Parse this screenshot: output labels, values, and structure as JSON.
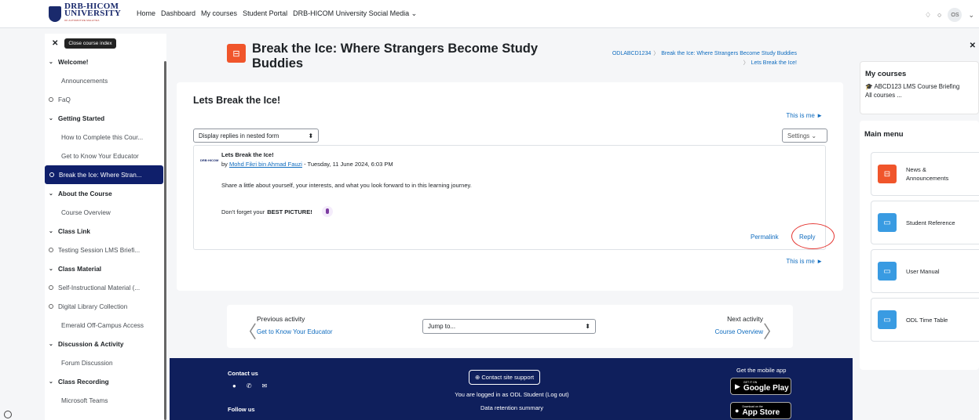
{
  "topbar": {
    "logo_line1": "DRB-HICOM",
    "logo_line2": "UNIVERSITY",
    "logo_tag": "OF AUTOMOTIVE MALAYSIA",
    "nav": [
      "Home",
      "Dashboard",
      "My courses",
      "Student Portal",
      "DRB-HICOM University Social Media ⌄"
    ],
    "bell": "♫",
    "chat": "▭",
    "avatar": "OS",
    "avatar_caret": "⌄"
  },
  "sidebar": {
    "close_tooltip": "Close course index",
    "items": [
      {
        "type": "section",
        "label": "Welcome!"
      },
      {
        "type": "item",
        "label": "Announcements"
      },
      {
        "type": "circle",
        "label": "FaQ"
      },
      {
        "type": "section",
        "label": "Getting Started"
      },
      {
        "type": "item",
        "label": "How to Complete this Cour..."
      },
      {
        "type": "item",
        "label": "Get to Know Your Educator"
      },
      {
        "type": "active",
        "label": "Break the Ice: Where Stran..."
      },
      {
        "type": "section",
        "label": "About the Course"
      },
      {
        "type": "item",
        "label": "Course Overview"
      },
      {
        "type": "section",
        "label": "Class Link"
      },
      {
        "type": "circle",
        "label": "Testing Session LMS Briefi..."
      },
      {
        "type": "section",
        "label": "Class Material"
      },
      {
        "type": "circle",
        "label": "Self-Instructional Material (..."
      },
      {
        "type": "circle",
        "label": "Digital Library Collection"
      },
      {
        "type": "item",
        "label": "Emerald Off-Campus Access"
      },
      {
        "type": "section",
        "label": "Discussion & Activity"
      },
      {
        "type": "item",
        "label": "Forum Discussion"
      },
      {
        "type": "section",
        "label": "Class Recording"
      },
      {
        "type": "item",
        "label": "Microsoft Teams"
      }
    ]
  },
  "header": {
    "title": "Break the Ice: Where Strangers Become Study Buddies",
    "breadcrumb": [
      "ODLABCD1234",
      "Break the Ice: Where Strangers Become Study Buddies",
      "Lets Break the Ice!"
    ]
  },
  "discussion": {
    "title": "Lets Break the Ice!",
    "this_is_me": "This is me ►",
    "display_mode": "Display replies in nested form",
    "settings": "Settings ⌄",
    "post": {
      "title": "Lets Break the Ice!",
      "by_prefix": "by ",
      "author": "Mohd Fikri bin Ahmad Fauzi",
      "date": " - Tuesday, 11 June 2024, 6:03 PM",
      "body1": "Share a little about yourself, your interests, and what you look forward to in this learning journey.",
      "body2_prefix": "Don't forget your",
      "body2_bold": "BEST PICTURE!",
      "permalink": "Permalink",
      "reply": "Reply"
    }
  },
  "activity_nav": {
    "prev_label": "Previous activity",
    "prev_link": "Get to Know Your Educator",
    "jump": "Jump to...",
    "next_label": "Next activity",
    "next_link": "Course Overview"
  },
  "footer": {
    "contact": "Contact us",
    "follow": "Follow us",
    "support": "Contact site support",
    "logged_in": "You are logged in as ODL Student (Log out)",
    "retention": "Data retention summary",
    "mobile": "Get the mobile app",
    "gp_small": "GET IT ON",
    "gp": "Google Play",
    "as_small": "Download on the",
    "as": "App Store"
  },
  "right": {
    "my_courses": "My courses",
    "course_link": "ABCD123 LMS Course Briefing",
    "all_courses": "All courses ...",
    "main_menu": "Main menu",
    "tiles": [
      {
        "label": "News & Announcements",
        "color": "#f0552b"
      },
      {
        "label": "Student Reference",
        "color": "#399be2"
      },
      {
        "label": "User Manual",
        "color": "#399be2"
      },
      {
        "label": "ODL Time Table",
        "color": "#399be2"
      }
    ]
  }
}
